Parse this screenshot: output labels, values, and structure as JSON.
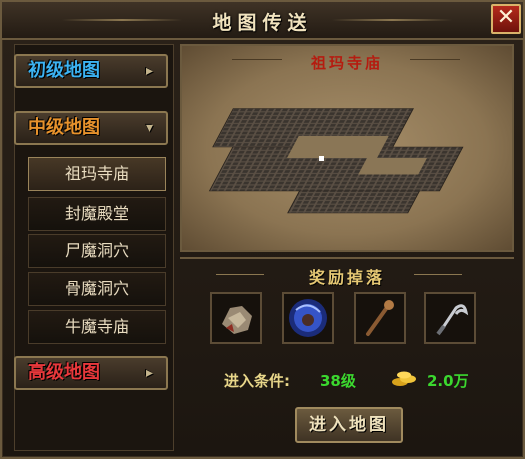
{
  "window": {
    "title": "地图传送",
    "close_label": "✕"
  },
  "categories": [
    {
      "label": "初级地图",
      "color": "#3cb3f2",
      "arrow": "▸"
    },
    {
      "label": "中级地图",
      "color": "#e7922c",
      "arrow": "▾"
    },
    {
      "label": "高级地图",
      "color": "#e8383b",
      "arrow": "▸"
    }
  ],
  "maps": [
    {
      "label": "祖玛寺庙",
      "selected": true
    },
    {
      "label": "封魔殿堂",
      "selected": false
    },
    {
      "label": "尸魔洞穴",
      "selected": false
    },
    {
      "label": "骨魔洞穴",
      "selected": false
    },
    {
      "label": "牛魔寺庙",
      "selected": false
    }
  ],
  "preview": {
    "map_name": "祖玛寺庙"
  },
  "rewards": {
    "title": "奖励掉落",
    "items": [
      {
        "icon": "armor-icon"
      },
      {
        "icon": "blue-orb-icon"
      },
      {
        "icon": "staff-icon"
      },
      {
        "icon": "sickle-icon"
      }
    ]
  },
  "condition": {
    "label": "进入条件:",
    "level": "38级",
    "gold_amount": "2.0万"
  },
  "enter_button": {
    "label": "进入地图"
  }
}
